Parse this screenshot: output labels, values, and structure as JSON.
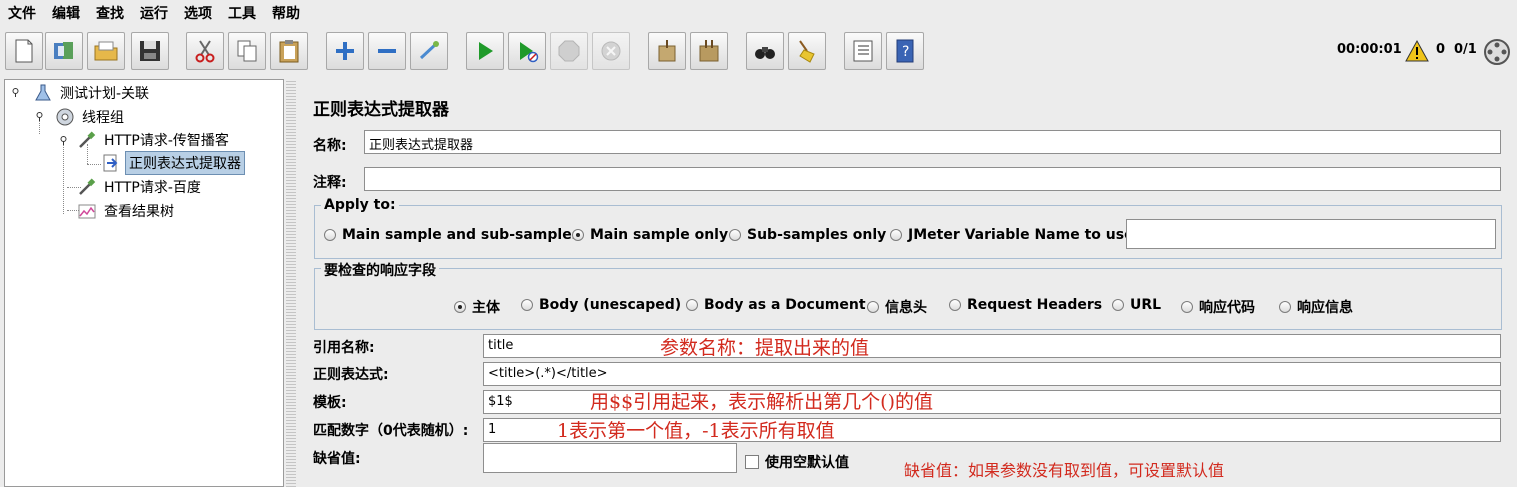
{
  "menu": [
    "文件",
    "编辑",
    "查找",
    "运行",
    "选项",
    "工具",
    "帮助"
  ],
  "status": {
    "timer": "00:00:01",
    "warnings": "0",
    "threads": "0/1"
  },
  "tree": {
    "plan": "测试计划-关联",
    "thread_group": "线程组",
    "http1": "HTTP请求-传智播客",
    "extractor": "正则表达式提取器",
    "http2": "HTTP请求-百度",
    "results": "查看结果树"
  },
  "panel": {
    "title": "正则表达式提取器",
    "name_label": "名称:",
    "name_value": "正则表达式提取器",
    "comment_label": "注释:",
    "comment_value": "",
    "apply_to": {
      "label": "Apply to:",
      "options": [
        "Main sample and sub-samples",
        "Main sample only",
        "Sub-samples only",
        "JMeter Variable Name to use"
      ],
      "selected_index": 1,
      "var_value": ""
    },
    "fields_group": {
      "label": "要检查的响应字段",
      "options": [
        "主体",
        "Body (unescaped)",
        "Body as a Document",
        "信息头",
        "Request Headers",
        "URL",
        "响应代码",
        "响应信息"
      ],
      "selected_index": 0
    },
    "ref_label": "引用名称:",
    "ref_value": "title",
    "regex_label": "正则表达式:",
    "regex_value": "<title>(.*)</title>",
    "template_label": "模板:",
    "template_value": "$1$",
    "match_label": "匹配数字（0代表随机）:",
    "match_value": "1",
    "default_label": "缺省值:",
    "default_value": "",
    "empty_default_label": "使用空默认值"
  },
  "annotations": {
    "ref": "参数名称：提取出来的值",
    "template": "用$$引用起来，表示解析出第几个()的值",
    "match": "1表示第一个值，-1表示所有取值",
    "default": "缺省值：如果参数没有取到值，可设置默认值"
  },
  "colors": {
    "annotation": "#d22a1e",
    "selection": "#b8cfe5",
    "panel_bg": "#ececec"
  }
}
